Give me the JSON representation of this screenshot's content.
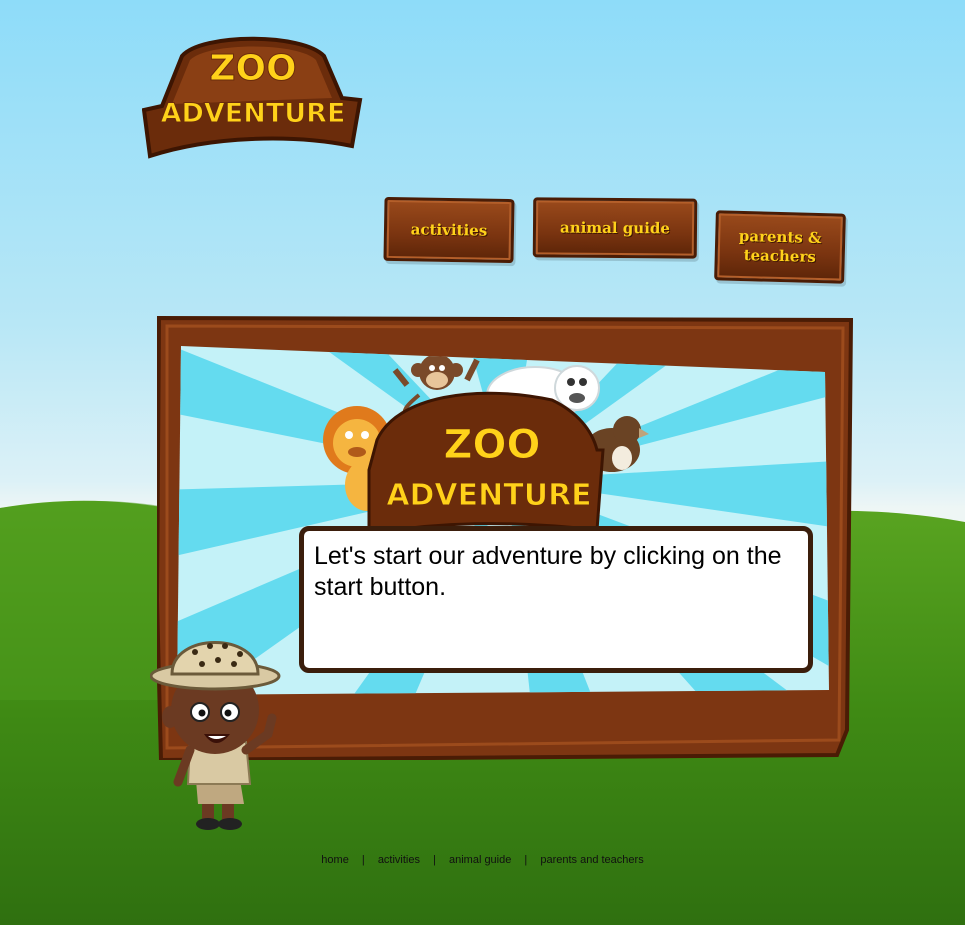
{
  "logo": {
    "line1": "ZOO",
    "line2": "ADVENTURE"
  },
  "nav": {
    "activities": "activities",
    "animal_guide": "animal guide",
    "parents_teachers_1": "parents &",
    "parents_teachers_2": "teachers"
  },
  "screen_logo": {
    "line1": "ZOO",
    "line2": "ADVENTURE"
  },
  "speech": {
    "text": "Let's start our adventure by clicking on the start button."
  },
  "footer": {
    "home": "home",
    "activities": "activities",
    "animal_guide": "animal guide",
    "parents_teachers": "parents and teachers",
    "separator": "|"
  },
  "colors": {
    "sky": "#8edcf9",
    "grass": "#3f8a14",
    "wood": "#7a3410",
    "logo_text": "#ffd21a"
  }
}
